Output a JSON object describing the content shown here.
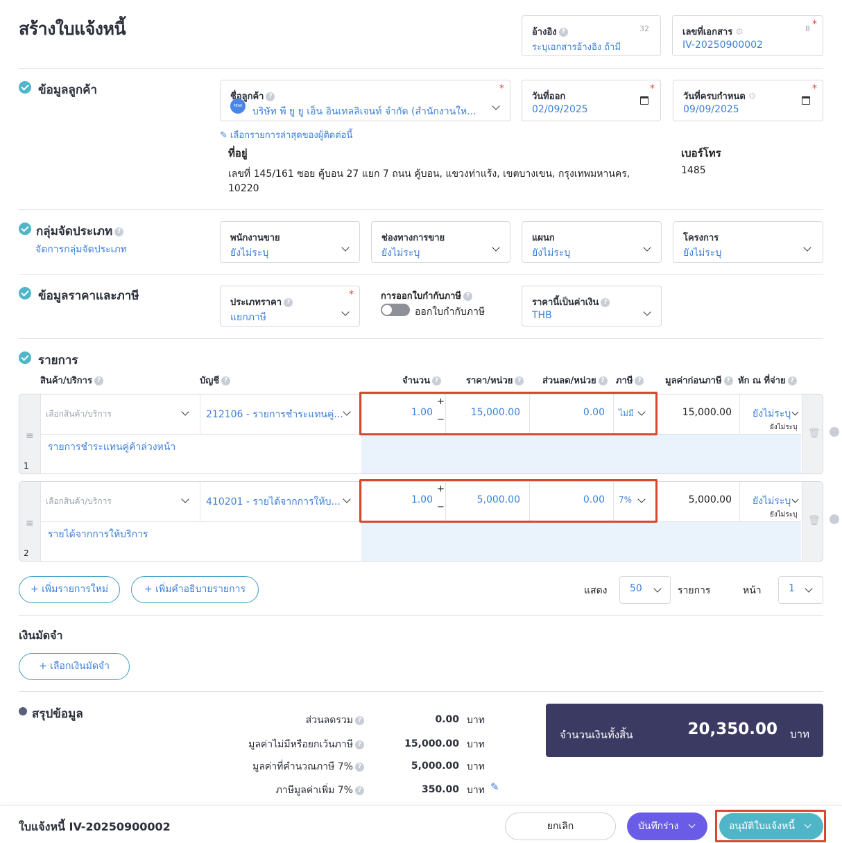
{
  "page": {
    "title": "สร้างใบแจ้งหนี้"
  },
  "reference": {
    "label": "อ้างอิง",
    "counter": "32",
    "placeholder": "ระบุเอกสารอ้างอิง ถ้ามี"
  },
  "doc_number": {
    "label": "เลขที่เอกสาร",
    "counter": "8",
    "value": "IV-20250900002"
  },
  "customer": {
    "section_title": "ข้อมูลลูกค้า",
    "name_label": "ชื่อลูกค้า",
    "name_value": "บริษัท พี ยู ยู เอ็น อินเทลลิเจนท์ จำกัด (สำนักงานให...",
    "avatar_text": "PEAK",
    "issue_date_label": "วันที่ออก",
    "issue_date": "02/09/2025",
    "due_date_label": "วันที่ครบกำหนด",
    "due_date": "09/09/2025",
    "latest_link": "เลือกรายการล่าสุดของผู้ติดต่อนี้",
    "address_label": "ที่อยู่",
    "address_line1": "เลขที่ 145/161 ซอย คู้บอน 27 แยก 7 ถนน คู้บอน, แขวงท่าแร้ง, เขตบางเขน, กรุงเทพมหานคร,",
    "address_line2": "10220",
    "phone_label": "เบอร์โทร",
    "phone": "1485"
  },
  "category": {
    "section_title": "กลุ่มจัดประเภท",
    "manage_link": "จัดการกลุ่มจัดประเภท",
    "fields": [
      {
        "label": "พนักงานขาย",
        "value": "ยังไม่ระบุ"
      },
      {
        "label": "ช่องทางการขาย",
        "value": "ยังไม่ระบุ"
      },
      {
        "label": "แผนก",
        "value": "ยังไม่ระบุ"
      },
      {
        "label": "โครงการ",
        "value": "ยังไม่ระบุ"
      }
    ]
  },
  "pricing": {
    "section_title": "ข้อมูลราคาและภาษี",
    "price_type_label": "ประเภทราคา",
    "price_type_value": "แยกภาษี",
    "tax_invoice_label": "การออกใบกำกับภาษี",
    "tax_invoice_toggle_label": "ออกใบกำกับภาษี",
    "tax_invoice_enabled": false,
    "currency_label": "ราคานี้เป็นค่าเงิน",
    "currency_value": "THB"
  },
  "items": {
    "section_title": "รายการ",
    "columns": {
      "product": "สินค้า/บริการ",
      "account": "บัญชี",
      "qty": "จำนวน",
      "price": "ราคา/หน่วย",
      "discount": "ส่วนลด/หน่วย",
      "tax": "ภาษี",
      "pretax": "มูลค่าก่อนภาษี",
      "wht": "หัก ณ ที่จ่าย"
    },
    "rows": [
      {
        "index": "1",
        "product_placeholder": "เลือกสินค้า/บริการ",
        "account": "212106 - รายการชำระแทนคู่...",
        "qty": "1.00",
        "price": "15,000.00",
        "discount": "0.00",
        "tax": "ไม่มี",
        "pretax": "15,000.00",
        "wht": "ยังไม่ระบุ",
        "wht_sub": "ยังไม่ระบุ",
        "description": "รายการชำระแทนคู่ค้าล่วงหน้า"
      },
      {
        "index": "2",
        "product_placeholder": "เลือกสินค้า/บริการ",
        "account": "410201 - รายได้จากการให้บ...",
        "qty": "1.00",
        "price": "5,000.00",
        "discount": "0.00",
        "tax": "7%",
        "pretax": "5,000.00",
        "wht": "ยังไม่ระบุ",
        "wht_sub": "ยังไม่ระบุ",
        "description": "รายได้จากการให้บริการ"
      }
    ],
    "add_item_button": "เพิ่มรายการใหม่",
    "add_desc_button": "เพิ่มคำอธิบายรายการ",
    "show_label": "แสดง",
    "page_size": "50",
    "items_label": "รายการ",
    "page_label": "หน้า",
    "page_number": "1"
  },
  "deposit": {
    "title": "เงินมัดจำ",
    "button": "เลือกเงินมัดจำ"
  },
  "summary": {
    "title": "สรุปข้อมูล",
    "lines": [
      {
        "label": "ส่วนลดรวม",
        "value": "0.00",
        "unit": "บาท"
      },
      {
        "label": "มูลค่าไม่มีหรือยกเว้นภาษี",
        "value": "15,000.00",
        "unit": "บาท"
      },
      {
        "label": "มูลค่าที่คำนวณภาษี 7%",
        "value": "5,000.00",
        "unit": "บาท"
      },
      {
        "label": "ภาษีมูลค่าเพิ่ม 7%",
        "value": "350.00",
        "unit": "บาท"
      }
    ],
    "total_label": "จำนวนเงินทั้งสิ้น",
    "total_value": "20,350.00",
    "total_unit": "บาท"
  },
  "footer": {
    "doc_title": "ใบแจ้งหนี้ IV-20250900002",
    "cancel": "ยกเลิก",
    "save_draft": "บันทึกร่าง",
    "approve": "อนุมัติใบแจ้งหนี้"
  },
  "colors": {
    "accent_blue": "#3d7fd8",
    "teal": "#4fb6c8",
    "purple": "#6a5ce6",
    "navy": "#3b3a63",
    "highlight_red": "#d9472f"
  }
}
